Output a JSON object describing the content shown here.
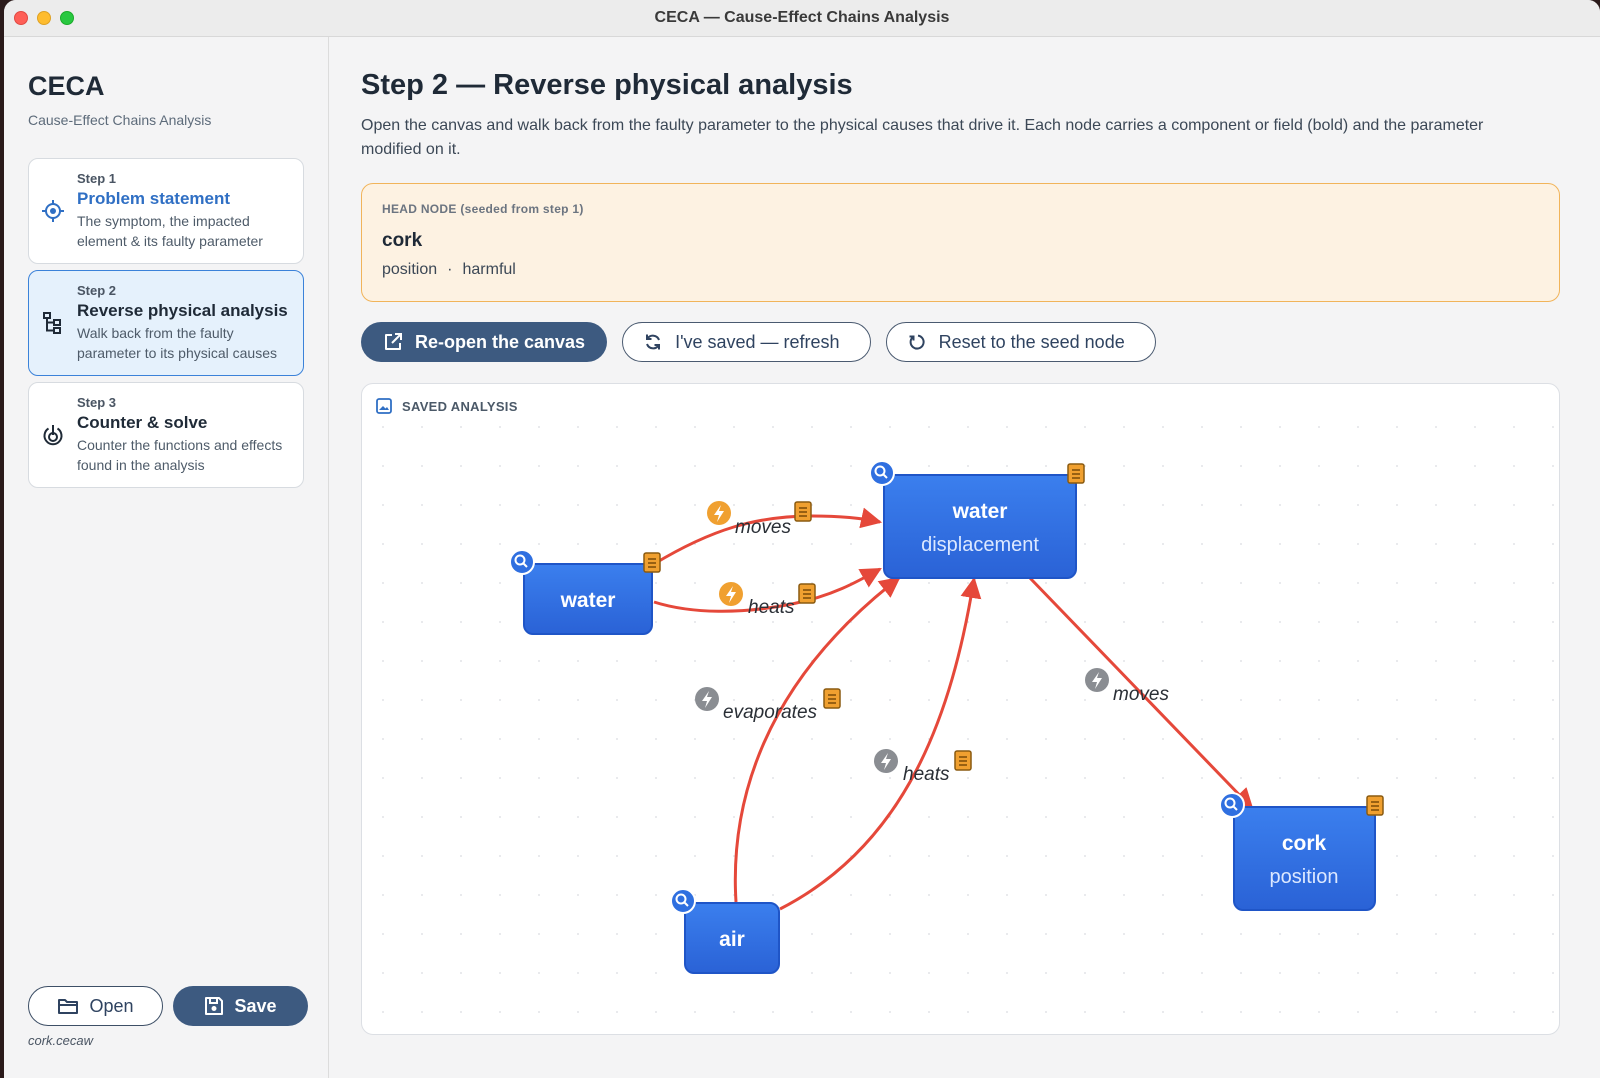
{
  "window": {
    "title": "CECA — Cause-Effect Chains Analysis"
  },
  "sidebar": {
    "app_name": "CECA",
    "app_subtitle": "Cause-Effect Chains Analysis",
    "steps": [
      {
        "num": "Step 1",
        "title": "Problem statement",
        "desc": "The symptom, the impacted element & its faulty parameter",
        "icon": "target-icon"
      },
      {
        "num": "Step 2",
        "title": "Reverse physical analysis",
        "desc": "Walk back from the faulty parameter to its physical causes",
        "icon": "tree-icon"
      },
      {
        "num": "Step 3",
        "title": "Counter & solve",
        "desc": "Counter the functions and effects found in the analysis",
        "icon": "power-target-icon"
      }
    ],
    "open_label": "Open",
    "save_label": "Save",
    "file_name": "cork.cecaw"
  },
  "main": {
    "title": "Step 2 — Reverse physical analysis",
    "description": "Open the canvas and walk back from the faulty parameter to the physical causes that drive it. Each node carries a component or field (bold) and the parameter modified on it.",
    "head_node": {
      "label": "HEAD NODE (seeded from step 1)",
      "name": "cork",
      "parameter": "position",
      "separator": "·",
      "kind": "harmful"
    },
    "actions": {
      "reopen": "Re-open the canvas",
      "refresh": "I've saved — refresh",
      "reset": "Reset to the seed node"
    },
    "analysis": {
      "label": "SAVED ANALYSIS",
      "nodes": [
        {
          "id": "water-displacement",
          "component": "water",
          "parameter": "displacement"
        },
        {
          "id": "water",
          "component": "water",
          "parameter": ""
        },
        {
          "id": "air",
          "component": "air",
          "parameter": ""
        },
        {
          "id": "cork-position",
          "component": "cork",
          "parameter": "position"
        }
      ],
      "edges": [
        {
          "from": "water",
          "to": "water-displacement",
          "label": "moves",
          "bolt": "orange"
        },
        {
          "from": "water",
          "to": "water-displacement",
          "label": "heats",
          "bolt": "orange"
        },
        {
          "from": "air",
          "to": "water-displacement",
          "label": "evaporates",
          "bolt": "gray"
        },
        {
          "from": "air",
          "to": "water-displacement",
          "label": "heats",
          "bolt": "gray"
        },
        {
          "from": "water-displacement",
          "to": "cork-position",
          "label": "moves",
          "bolt": "gray"
        }
      ]
    }
  },
  "colors": {
    "accent": "#3d5a80",
    "node_blue": "#2f6fe0",
    "edge_red": "#e5483a",
    "bolt_orange": "#f0a030",
    "bolt_gray": "#8a8d92",
    "note_orange": "#f0a030"
  }
}
